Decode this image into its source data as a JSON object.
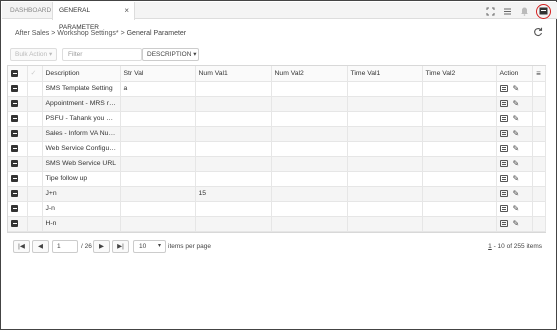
{
  "tabs": {
    "dashboard": "DASHBOARD",
    "active": "GENERAL PARAMETER",
    "close": "×"
  },
  "top_icons": [
    "expand-icon",
    "list-menu-icon",
    "bell-icon",
    "user-card-icon"
  ],
  "breadcrumb": {
    "level1": "After Sales",
    "sep": ">",
    "level2": "Workshop Settings*",
    "current": "General Parameter"
  },
  "toolbar": {
    "bulk_action": "Bulk Action ▾",
    "filter_placeholder": "Filter",
    "filter_column": "DESCRIPTION ▾"
  },
  "table": {
    "headers": [
      "Description",
      "Str Val",
      "Num Val1",
      "Num Val2",
      "Time Val1",
      "Time Val2",
      "Action"
    ],
    "rows": [
      [
        "SMS Template Setting",
        "a",
        "",
        "",
        "",
        ""
      ],
      [
        "Appointment - MRS re...",
        "",
        "",
        "",
        "",
        ""
      ],
      [
        "PSFU - Tahank you note",
        "",
        "",
        "",
        "",
        ""
      ],
      [
        "Sales - Inform VA Num...",
        "",
        "",
        "",
        "",
        ""
      ],
      [
        "Web Service Configur...",
        "",
        "",
        "",
        "",
        ""
      ],
      [
        "SMS Web Service URL",
        "",
        "",
        "",
        "",
        ""
      ],
      [
        "Tipe follow up",
        "",
        "",
        "",
        "",
        ""
      ],
      [
        "J+n",
        "",
        "15",
        "",
        "",
        ""
      ],
      [
        "J-n",
        "",
        "",
        "",
        "",
        ""
      ],
      [
        "H-n",
        "",
        "",
        "",
        "",
        ""
      ]
    ]
  },
  "pager": {
    "current_page": "1",
    "total": "/ 26",
    "page_size": "10",
    "page_size_label": "items per page",
    "info_prefix": "1",
    "info_rest": "- 10 of 255 items"
  }
}
